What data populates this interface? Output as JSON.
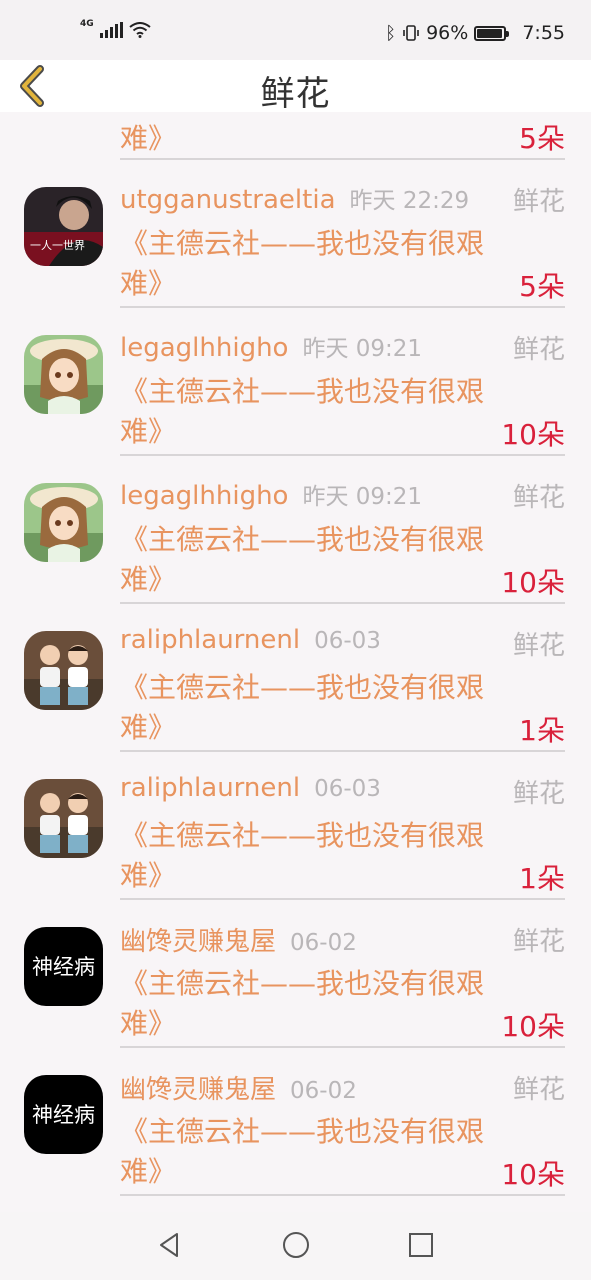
{
  "status_bar": {
    "network": "4G",
    "battery_percent": "96%",
    "battery_level": 0.96,
    "time": "7:55",
    "icons": [
      "signal-icon",
      "wifi-icon",
      "bluetooth-icon",
      "vibrate-icon",
      "battery-icon"
    ]
  },
  "header": {
    "title": "鲜花",
    "back_icon": "chevron-left-icon",
    "accent": "#e1b43c"
  },
  "partial_row": {
    "message_tail": "难》",
    "amount": "5朵"
  },
  "rows": [
    {
      "name": "utgganustraeltia",
      "time": "昨天 22:29",
      "kind": "鲜花",
      "message": "《主德云社——我也没有很艰难》",
      "amount": "5朵",
      "avatar": "avatar-dark-photo"
    },
    {
      "name": "legaglhhigho",
      "time": "昨天 09:21",
      "kind": "鲜花",
      "message": "《主德云社——我也没有很艰难》",
      "amount": "10朵",
      "avatar": "avatar-anime-girl"
    },
    {
      "name": "legaglhhigho",
      "time": "昨天 09:21",
      "kind": "鲜花",
      "message": "《主德云社——我也没有很艰难》",
      "amount": "10朵",
      "avatar": "avatar-anime-girl"
    },
    {
      "name": "raliphlaurnenl",
      "time": "06-03",
      "kind": "鲜花",
      "message": "《主德云社——我也没有很艰难》",
      "amount": "1朵",
      "avatar": "avatar-two-kids"
    },
    {
      "name": "raliphlaurnenl",
      "time": "06-03",
      "kind": "鲜花",
      "message": "《主德云社——我也没有很艰难》",
      "amount": "1朵",
      "avatar": "avatar-two-kids"
    },
    {
      "name": "幽馋灵赚鬼屋",
      "time": "06-02",
      "kind": "鲜花",
      "message": "《主德云社——我也没有很艰难》",
      "amount": "10朵",
      "avatar": "avatar-black-logo"
    },
    {
      "name": "幽馋灵赚鬼屋",
      "time": "06-02",
      "kind": "鲜花",
      "message": "《主德云社——我也没有很艰难》",
      "amount": "10朵",
      "avatar": "avatar-black-logo"
    }
  ],
  "avatar_texts": {
    "dark_photo": "一人一世界",
    "black_logo": "神经病"
  },
  "colors": {
    "name_orange": "#e8945f",
    "amount_red": "#d9213b",
    "meta_gray": "#b9b6b8",
    "divider": "#d8d5d7",
    "background": "#f8f5f7"
  },
  "navbar": {
    "icons": [
      "back-triangle-icon",
      "home-circle-icon",
      "recents-square-icon"
    ]
  }
}
